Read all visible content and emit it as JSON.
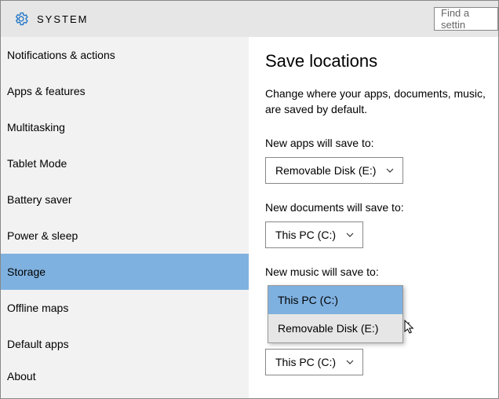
{
  "header": {
    "title": "SYSTEM",
    "search_placeholder": "Find a settin"
  },
  "sidebar": {
    "items": [
      {
        "label": "Notifications & actions"
      },
      {
        "label": "Apps & features"
      },
      {
        "label": "Multitasking"
      },
      {
        "label": "Tablet Mode"
      },
      {
        "label": "Battery saver"
      },
      {
        "label": "Power & sleep"
      },
      {
        "label": "Storage",
        "selected": true
      },
      {
        "label": "Offline maps"
      },
      {
        "label": "Default apps"
      },
      {
        "label": "About"
      }
    ]
  },
  "content": {
    "title": "Save locations",
    "description": "Change where your apps, documents, music, are saved by default.",
    "groups": [
      {
        "label": "New apps will save to:",
        "value": "Removable Disk (E:)"
      },
      {
        "label": "New documents will save to:",
        "value": "This PC (C:)"
      },
      {
        "label": "New music will save to:",
        "value": "This PC (C:)",
        "options": [
          "This PC (C:)",
          "Removable Disk (E:)"
        ],
        "open": true
      },
      {
        "label": "",
        "value": "This PC (C:)"
      }
    ],
    "trailing_colon": ":"
  },
  "colors": {
    "accent": "#7fb1e0",
    "panel": "#f2f2f2",
    "header": "#e6e6e6",
    "border": "#888"
  }
}
